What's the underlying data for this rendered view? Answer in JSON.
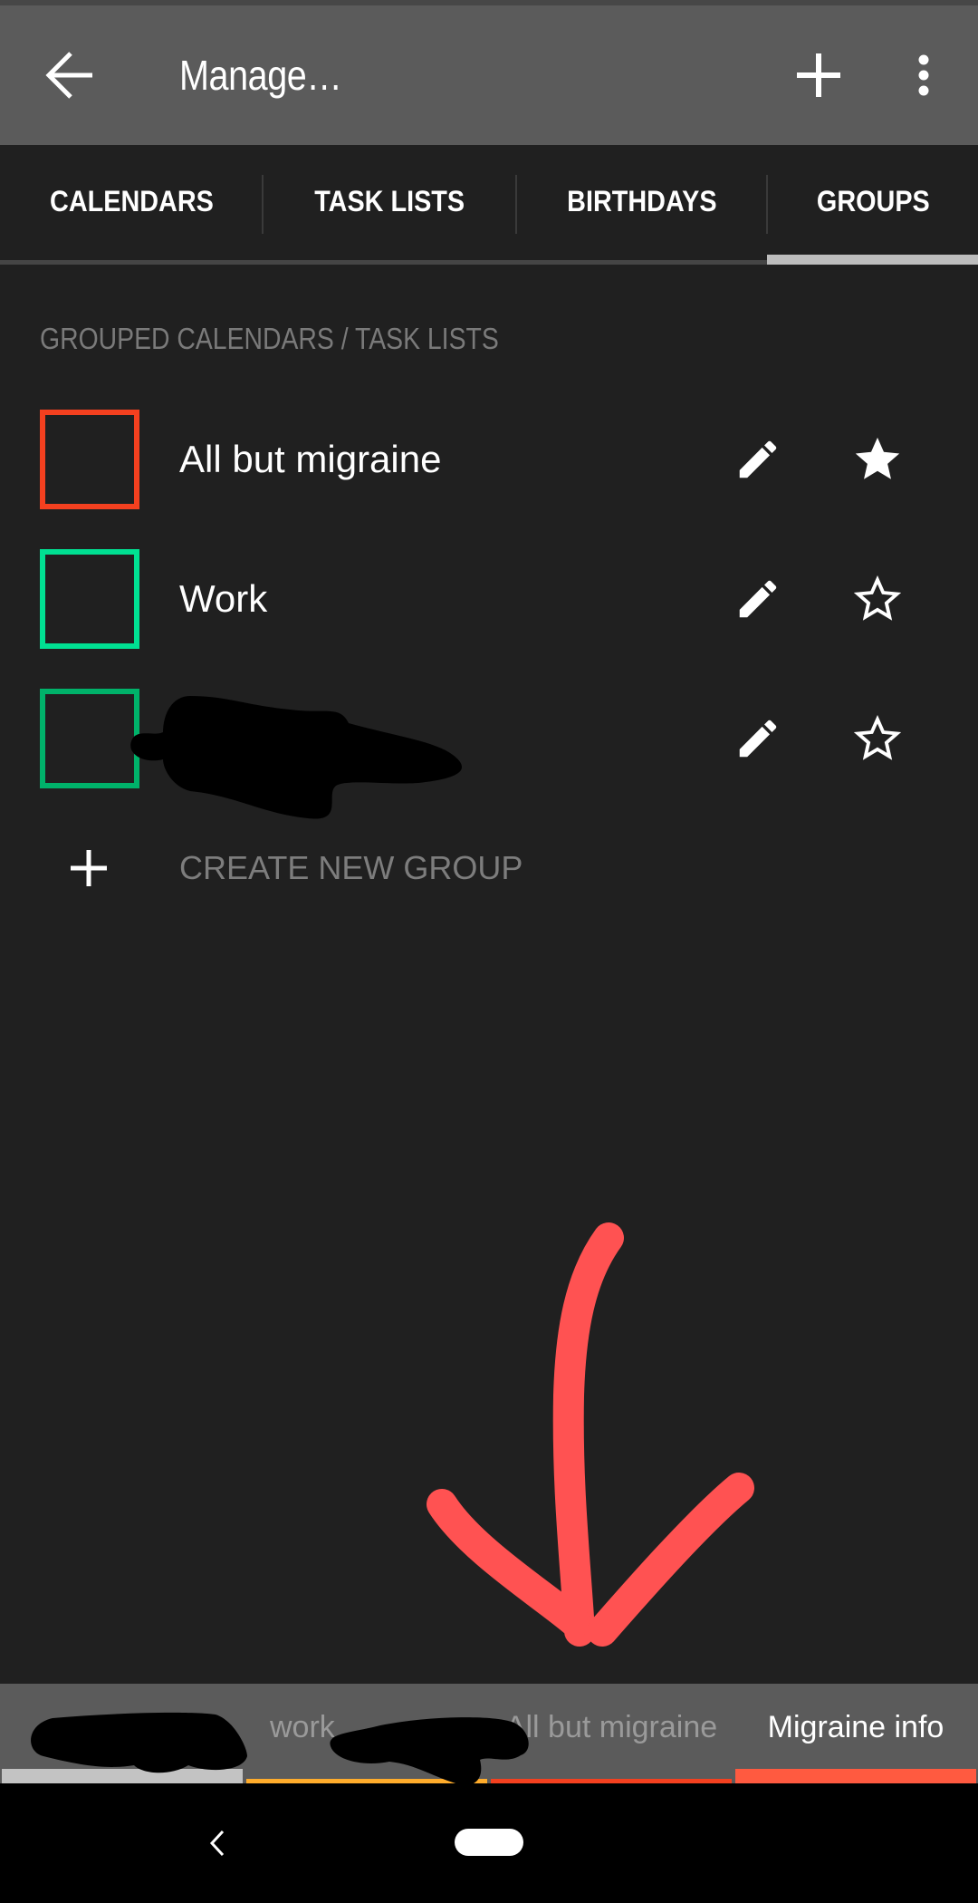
{
  "toolbar": {
    "title": "Manage…",
    "back_icon": "arrow-back-icon",
    "add_icon": "plus-icon",
    "more_icon": "more-vert-icon"
  },
  "tabs": [
    {
      "label": "CALENDARS",
      "active": false
    },
    {
      "label": "TASK LISTS",
      "active": false
    },
    {
      "label": "BIRTHDAYS",
      "active": false
    },
    {
      "label": "GROUPS",
      "active": true
    }
  ],
  "section_header": "GROUPED CALENDARS / TASK LISTS",
  "groups": [
    {
      "name": "All but migraine",
      "color": "#f4401f",
      "favorite": true,
      "redacted": false
    },
    {
      "name": "Work",
      "color": "#00e092",
      "favorite": false,
      "redacted": false
    },
    {
      "name": "",
      "color": "#00b26a",
      "favorite": false,
      "redacted": true
    }
  ],
  "create_group_label": "CREATE NEW GROUP",
  "annotation": {
    "type": "hand-drawn-arrow",
    "direction": "down",
    "color": "#ff5252"
  },
  "bottom_tabs": [
    {
      "label": "",
      "redacted": true,
      "indicator_color": "#c3c3c3",
      "active": false
    },
    {
      "label": "work",
      "redacted": true,
      "indicator_color": "#ffac2b",
      "active": false
    },
    {
      "label": "All but migraine",
      "redacted": false,
      "indicator_color": "#f4401f",
      "active": false
    },
    {
      "label": "Migraine info",
      "redacted": false,
      "indicator_color": "#ff5a40",
      "active": true
    }
  ],
  "navbar": {
    "back_icon": "nav-back-icon",
    "home_icon": "home-pill-icon"
  }
}
